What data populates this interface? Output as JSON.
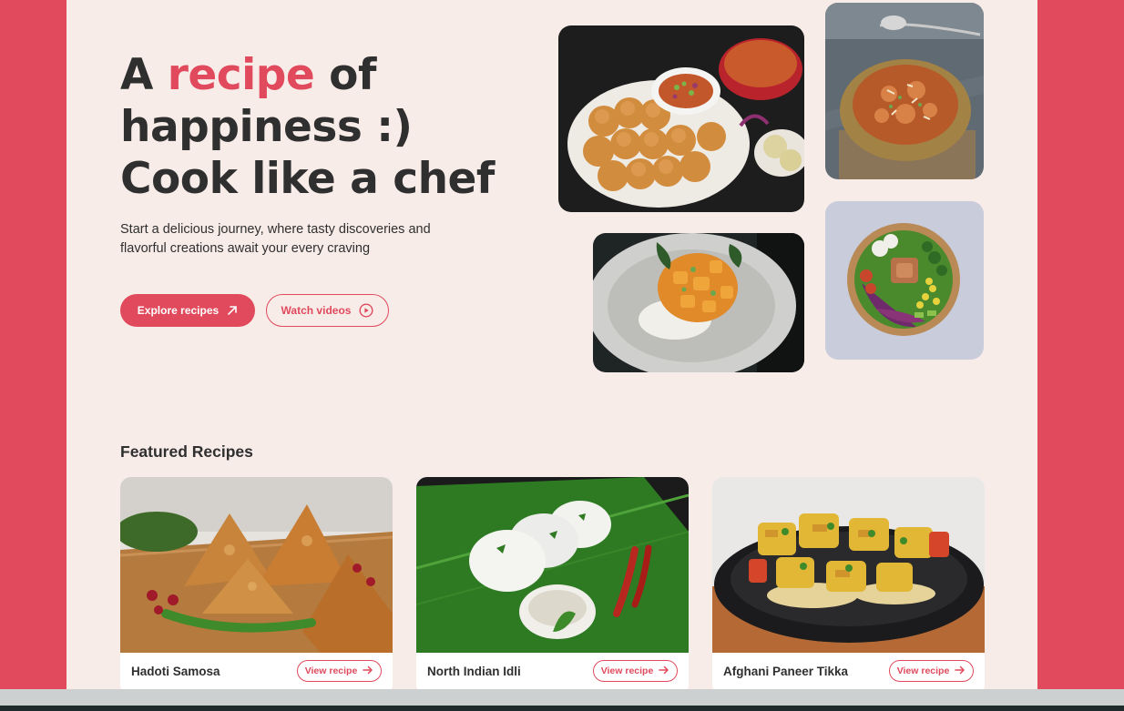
{
  "hero": {
    "title_part1": "A ",
    "title_accent": "recipe",
    "title_part2": " of",
    "title_line2": "happiness :)",
    "title_line3": "Cook like a chef",
    "subtitle": "Start a delicious journey, where tasty discoveries and flavorful creations await your every craving",
    "explore_label": "Explore recipes",
    "watch_label": "Watch videos"
  },
  "featured": {
    "title": "Featured Recipes",
    "cards": [
      {
        "name": "Hadoti Samosa",
        "action": "View recipe"
      },
      {
        "name": "North Indian Idli",
        "action": "View recipe"
      },
      {
        "name": "Afghani Paneer Tikka",
        "action": "View recipe"
      }
    ]
  },
  "icons": {
    "explore": "arrow-up-right-icon",
    "watch": "play-circle-icon",
    "view": "arrow-right-icon"
  },
  "colors": {
    "accent": "#e04a5c",
    "page_bg": "#f8ece9",
    "text": "#2f2f2f"
  }
}
